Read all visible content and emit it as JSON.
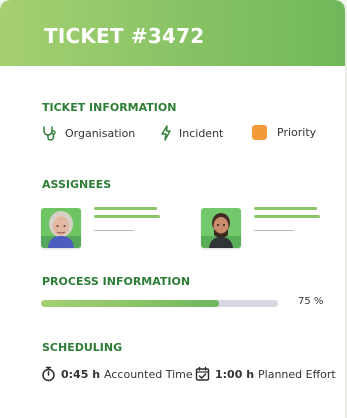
{
  "ticket": {
    "title": "TICKET #3472"
  },
  "ticket_information": {
    "heading": "TICKET INFORMATION",
    "organisation": "Organisation",
    "incident": "Incident",
    "priority": "Priority",
    "priority_color": "#f39a38"
  },
  "assignees": {
    "heading": "ASSIGNEES",
    "accent_color": "#8cc567"
  },
  "process_information": {
    "heading": "PROCESS INFORMATION",
    "percent": 75,
    "percent_text": "75 %"
  },
  "scheduling": {
    "heading": "SCHEDULING",
    "accounted_time_value": "0:45 h",
    "accounted_time_label": "Accounted Time",
    "planned_effort_value": "1:00 h",
    "planned_effort_label": "Planned Effort"
  },
  "icons": {
    "organisation": "stethoscope-icon",
    "incident": "bolt-icon",
    "accounted_time": "stopwatch-icon",
    "planned_effort": "calendar-check-icon"
  }
}
